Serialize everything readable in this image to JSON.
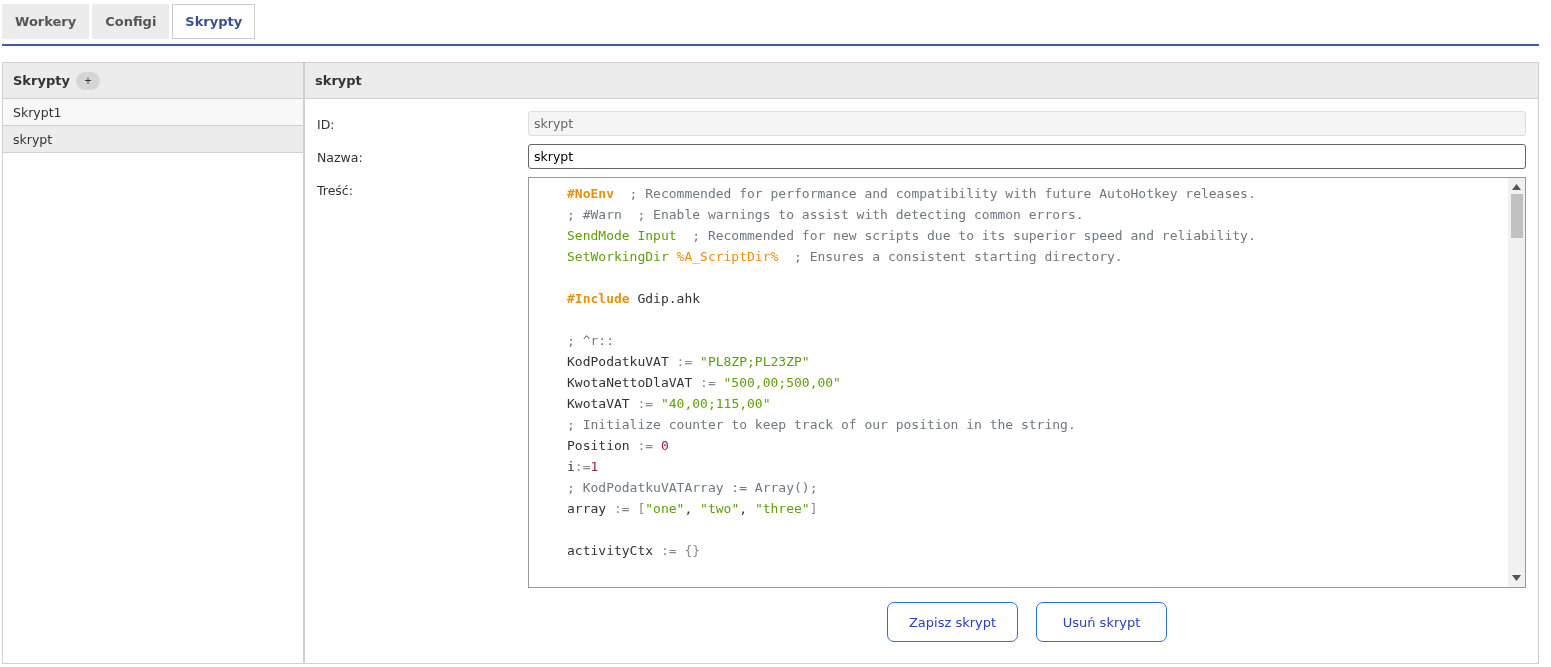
{
  "tabs": [
    {
      "label": "Workery",
      "selected": false
    },
    {
      "label": "Configi",
      "selected": false
    },
    {
      "label": "Skrypty",
      "selected": true
    }
  ],
  "sidebar": {
    "title": "Skrypty",
    "add_button": "+",
    "items": [
      {
        "label": "Skrypt1",
        "selected": false
      },
      {
        "label": "skrypt",
        "selected": true
      }
    ]
  },
  "editor": {
    "title": "skrypt",
    "fields": [
      {
        "label": "ID:",
        "kind": "input",
        "value": "skrypt",
        "disabled": true
      },
      {
        "label": "Nazwa:",
        "kind": "input",
        "value": "skrypt",
        "disabled": false
      },
      {
        "label": "Treść:",
        "kind": "code"
      }
    ],
    "code_lines": [
      {
        "kind": "code",
        "tokens": [
          {
            "text": "#NoEnv",
            "kind": "directive"
          },
          {
            "text": "  ; Recommended for performance and compatibility with future AutoHotkey releases.",
            "kind": "comment"
          }
        ]
      },
      {
        "kind": "code",
        "tokens": [
          {
            "text": "; #Warn  ; Enable warnings to assist with detecting common errors.",
            "kind": "comment"
          }
        ]
      },
      {
        "kind": "code",
        "tokens": [
          {
            "text": "SendMode Input",
            "kind": "command"
          },
          {
            "text": "  ; Recommended for new scripts due to its superior speed and reliability.",
            "kind": "comment"
          }
        ]
      },
      {
        "kind": "code",
        "tokens": [
          {
            "text": "SetWorkingDir",
            "kind": "command"
          },
          {
            "text": " %A_ScriptDir%",
            "kind": "variable"
          },
          {
            "text": "  ; Ensures a consistent starting directory.",
            "kind": "comment"
          }
        ]
      },
      {
        "kind": "blank"
      },
      {
        "kind": "code",
        "tokens": [
          {
            "text": "#Include",
            "kind": "directive"
          },
          {
            "text": " Gdip.ahk",
            "kind": "plain"
          }
        ]
      },
      {
        "kind": "blank"
      },
      {
        "kind": "code",
        "tokens": [
          {
            "text": "; ^r::",
            "kind": "comment"
          }
        ]
      },
      {
        "kind": "code",
        "tokens": [
          {
            "text": "KodPodatkuVAT ",
            "kind": "plain"
          },
          {
            "text": ":=",
            "kind": "operator"
          },
          {
            "text": " \"PL8ZP;PL23ZP\"",
            "kind": "string"
          }
        ]
      },
      {
        "kind": "code",
        "tokens": [
          {
            "text": "KwotaNettoDlaVAT ",
            "kind": "plain"
          },
          {
            "text": ":=",
            "kind": "operator"
          },
          {
            "text": " \"500,00;500,00\"",
            "kind": "string"
          }
        ]
      },
      {
        "kind": "code",
        "tokens": [
          {
            "text": "KwotaVAT ",
            "kind": "plain"
          },
          {
            "text": ":=",
            "kind": "operator"
          },
          {
            "text": " \"40,00;115,00\"",
            "kind": "string"
          }
        ]
      },
      {
        "kind": "code",
        "tokens": [
          {
            "text": "; Initialize counter to keep track of our position in the string.",
            "kind": "comment"
          }
        ]
      },
      {
        "kind": "code",
        "tokens": [
          {
            "text": "Position ",
            "kind": "plain"
          },
          {
            "text": ":=",
            "kind": "operator"
          },
          {
            "text": " 0",
            "kind": "number"
          }
        ]
      },
      {
        "kind": "code",
        "tokens": [
          {
            "text": "i",
            "kind": "plain"
          },
          {
            "text": ":=",
            "kind": "operator"
          },
          {
            "text": "1",
            "kind": "number"
          }
        ]
      },
      {
        "kind": "code",
        "tokens": [
          {
            "text": "; KodPodatkuVATArray := Array();",
            "kind": "comment"
          }
        ]
      },
      {
        "kind": "code",
        "tokens": [
          {
            "text": "array ",
            "kind": "plain"
          },
          {
            "text": ":= [",
            "kind": "operator"
          },
          {
            "text": "\"one\"",
            "kind": "string"
          },
          {
            "text": ", ",
            "kind": "plain"
          },
          {
            "text": "\"two\"",
            "kind": "string"
          },
          {
            "text": ", ",
            "kind": "plain"
          },
          {
            "text": "\"three\"",
            "kind": "string"
          },
          {
            "text": "]",
            "kind": "operator"
          }
        ]
      },
      {
        "kind": "blank"
      },
      {
        "kind": "code",
        "tokens": [
          {
            "text": "activityCtx ",
            "kind": "plain"
          },
          {
            "text": ":= {}",
            "kind": "operator"
          }
        ]
      }
    ],
    "buttons": [
      "Zapisz skrypt",
      "Usuń skrypt"
    ]
  }
}
